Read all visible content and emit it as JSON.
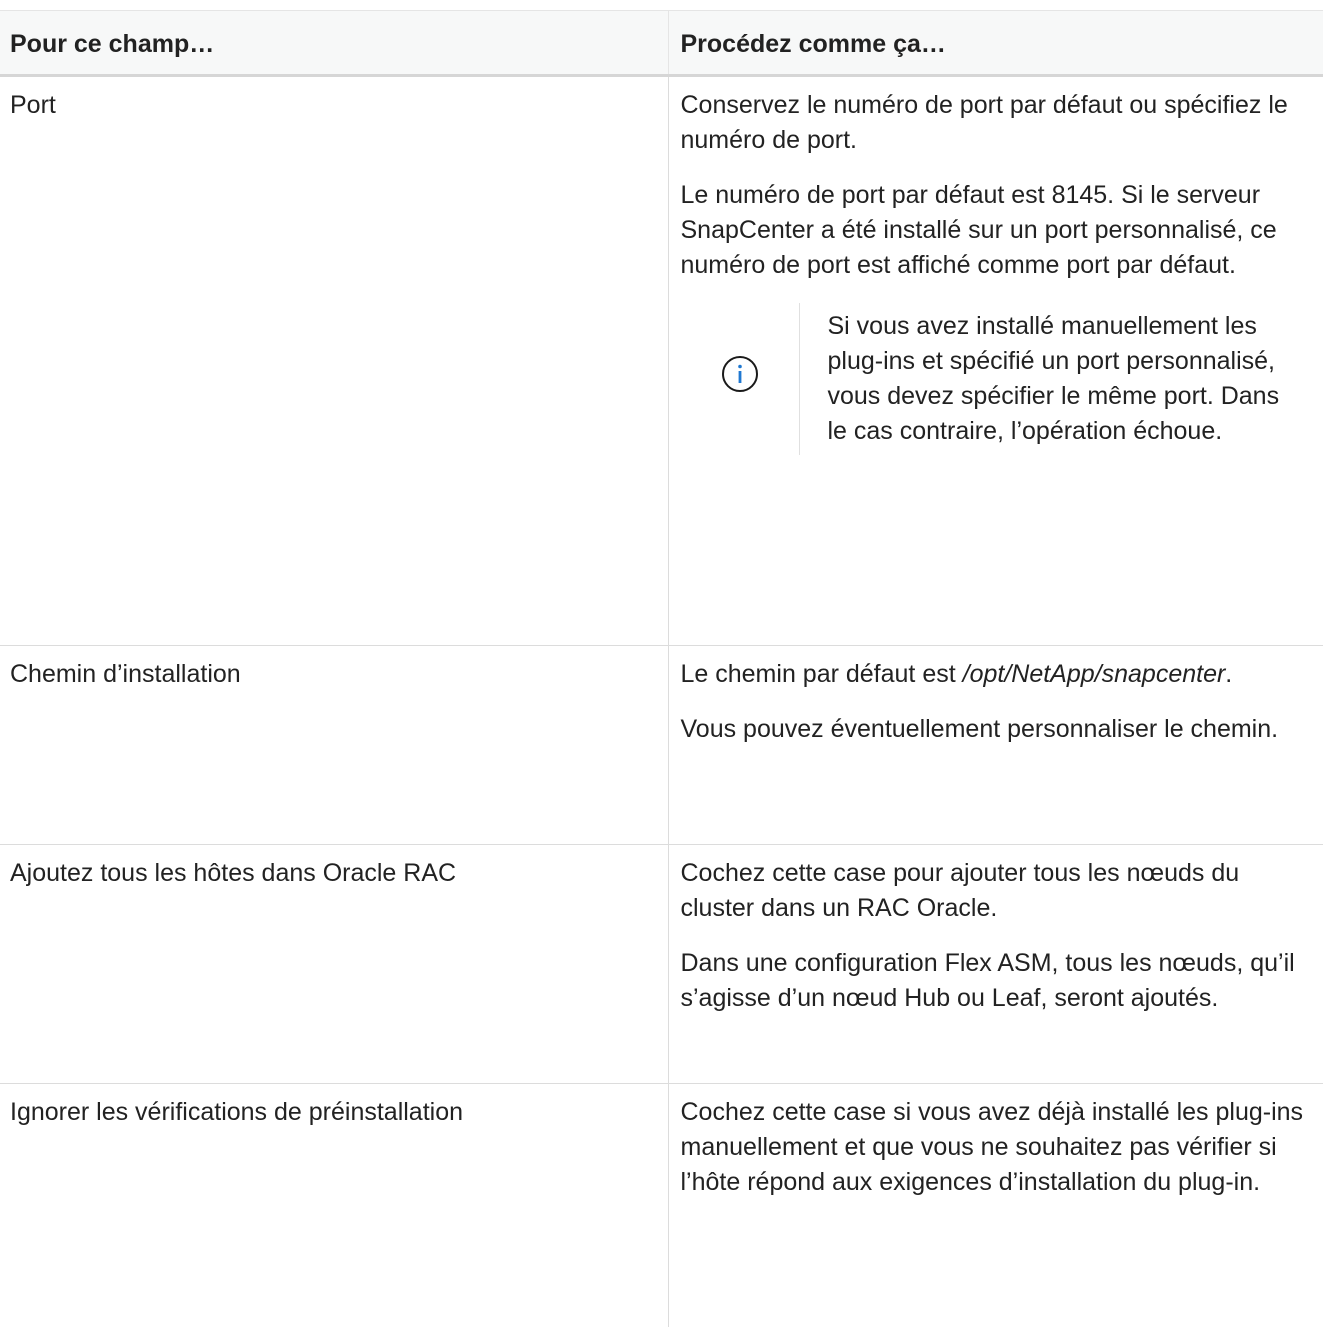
{
  "table": {
    "headers": [
      "Pour ce champ…",
      "Procédez comme ça…"
    ],
    "rows": {
      "port": {
        "field": "Port",
        "p1": "Conservez le numéro de port par défaut ou spécifiez le numéro de port.",
        "p2": "Le numéro de port par défaut est 8145. Si le serveur SnapCenter a été installé sur un port personnalisé, ce numéro de port est affiché comme port par défaut.",
        "note": {
          "icon": "info-circle-icon",
          "text": "Si vous avez installé manuellement les plug-ins et spécifié un port personnalisé, vous devez spécifier le même port. Dans le cas contraire, l’opération échoue."
        }
      },
      "path": {
        "field": "Chemin d’installation",
        "p1_prefix": "Le chemin par défaut est ",
        "p1_path": "/opt/NetApp/snapcenter",
        "p1_suffix": ".",
        "p2": "Vous pouvez éventuellement personnaliser le chemin."
      },
      "rac": {
        "field": "Ajoutez tous les hôtes dans Oracle RAC",
        "p1": "Cochez cette case pour ajouter tous les nœuds du cluster dans un RAC Oracle.",
        "p2": "Dans une configuration Flex ASM, tous les nœuds, qu’il s’agisse d’un nœud Hub ou Leaf, seront ajoutés."
      },
      "skip": {
        "field": "Ignorer les vérifications de préinstallation",
        "p1": "Cochez cette case si vous avez déjà installé les plug-ins manuellement et que vous ne souhaitez pas vérifier si l’hôte répond aux exigences d’installation du plug-in."
      }
    }
  },
  "colors": {
    "icon_stroke": "#1a1a1a",
    "icon_accent": "#1f78d1"
  }
}
